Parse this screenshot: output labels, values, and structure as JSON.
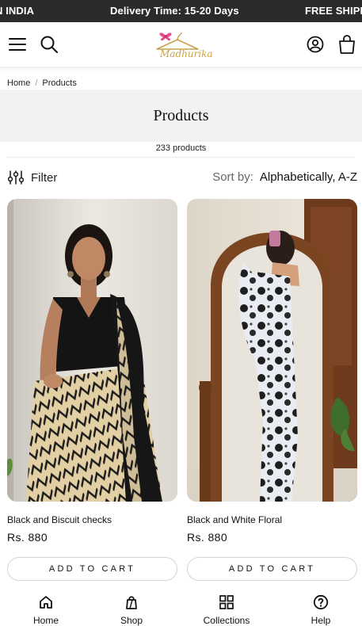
{
  "announcement": {
    "items": [
      "N INDIA",
      "Delivery Time: 15-20 Days",
      "FREE SHIPP"
    ]
  },
  "header": {
    "logo_text": "Madhurika",
    "icons": [
      "menu-icon",
      "search-icon",
      "account-icon",
      "cart-icon"
    ]
  },
  "breadcrumb": {
    "home": "Home",
    "separator": "/",
    "current": "Products"
  },
  "page": {
    "title": "Products",
    "count": "233 products"
  },
  "toolbar": {
    "filter_label": "Filter",
    "sort_label": "Sort by:",
    "sort_value": "Alphabetically, A-Z"
  },
  "products": [
    {
      "name": "Black and Biscuit checks",
      "price": "Rs. 880",
      "cta": "ADD TO CART"
    },
    {
      "name": "Black and White Floral",
      "price": "Rs. 880",
      "cta": "ADD TO CART"
    }
  ],
  "bottom_nav": [
    {
      "label": "Home",
      "icon": "home-icon"
    },
    {
      "label": "Shop",
      "icon": "shop-bag-icon"
    },
    {
      "label": "Collections",
      "icon": "grid-icon"
    },
    {
      "label": "Help",
      "icon": "help-circle-icon"
    }
  ],
  "colors": {
    "announcement_bg": "#2b2b2b",
    "title_band_bg": "#f3f2f0",
    "logo_gold": "#c8a24a",
    "logo_pink": "#e84a8a"
  }
}
